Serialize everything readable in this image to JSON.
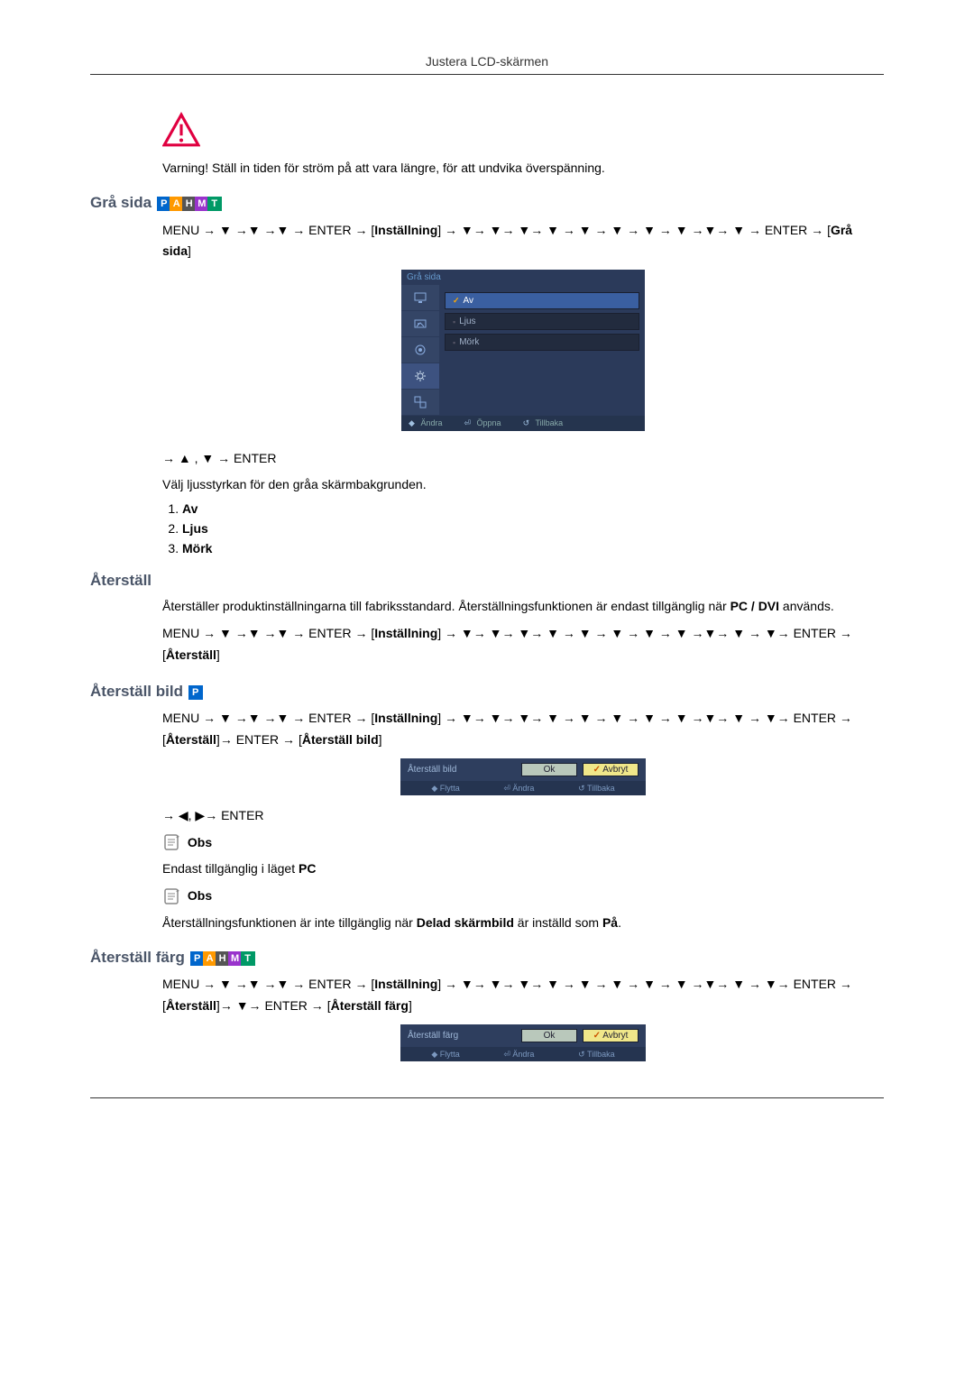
{
  "header": {
    "title": "Justera LCD-skärmen"
  },
  "warning": {
    "text": "Varning! Ställ in tiden för ström på att vara längre, för att undvika överspänning."
  },
  "sec_gra": {
    "title": "Grå sida",
    "badges": [
      "P",
      "A",
      "H",
      "M",
      "T"
    ],
    "path_prefix": "MENU → ▼ →▼ →▼ → ENTER → ",
    "path_bracket1": "Inställning",
    "path_mid": " → ▼→ ▼→ ▼→ ▼ → ▼ → ▼ → ▼ → ▼ →▼→ ▼ → ENTER → ",
    "path_bracket2": "Grå sida",
    "osd": {
      "title": "Grå sida",
      "items": [
        "Av",
        "Ljus",
        "Mörk"
      ],
      "selected_index": 0,
      "footer": {
        "a": "Ändra",
        "b": "Öppna",
        "c": "Tillbaka"
      }
    },
    "post_nav": "→ ▲ , ▼ → ENTER",
    "desc": "Välj ljusstyrkan för den gråa skärmbakgrunden.",
    "options": [
      "Av",
      "Ljus",
      "Mörk"
    ]
  },
  "sec_reset": {
    "title": "Återställ",
    "desc": "Återställer produktinställningarna till fabriksstandard. Återställningsfunktionen är endast tillgänglig när PC / DVI används.",
    "desc_bold": "PC / DVI",
    "path_prefix": "MENU → ▼ →▼ →▼ → ENTER → ",
    "path_bracket1": "Inställning",
    "path_mid": " → ▼→ ▼→ ▼→ ▼ → ▼ → ▼ → ▼ → ▼ →▼→ ▼ → ▼→ ENTER → ",
    "path_bracket2": "Återställ"
  },
  "sec_reset_pic": {
    "title": "Återställ bild",
    "badges": [
      "P"
    ],
    "path_prefix": "MENU → ▼ →▼ →▼ → ENTER → ",
    "path_bracket1": "Inställning",
    "path_mid": " → ▼→ ▼→ ▼→ ▼ → ▼ → ▼ → ▼ → ▼ →▼→ ▼ → ▼→ ENTER → ",
    "path_bracket2": "Återställ",
    "path_after": "→ ENTER → ",
    "path_bracket3": "Återställ bild",
    "dialog": {
      "title": "Återställ bild",
      "ok": "Ok",
      "cancel": "Avbryt",
      "footer": {
        "a": "Flytta",
        "b": "Ändra",
        "c": "Tillbaka"
      }
    },
    "post_nav": "→ ◀, ▶→ ENTER",
    "note_label": "Obs",
    "note1": "Endast tillgänglig i läget PC",
    "note1_bold": "PC",
    "note2": "Återställningsfunktionen är inte tillgänglig när Delad skärmbild är inställd som På.",
    "note2_bold1": "Delad skärmbild",
    "note2_bold2": "På"
  },
  "sec_reset_color": {
    "title": "Återställ färg",
    "badges": [
      "P",
      "A",
      "H",
      "M",
      "T"
    ],
    "path_prefix": "MENU → ▼ →▼ →▼ → ENTER → ",
    "path_bracket1": "Inställning",
    "path_mid": " → ▼→ ▼→ ▼→ ▼ → ▼ → ▼ → ▼ → ▼ →▼→ ▼ → ▼→ ENTER → ",
    "path_bracket2": "Återställ",
    "path_after": "→ ▼→ ENTER → ",
    "path_bracket3": "Återställ färg",
    "dialog": {
      "title": "Återställ färg",
      "ok": "Ok",
      "cancel": "Avbryt",
      "footer": {
        "a": "Flytta",
        "b": "Ändra",
        "c": "Tillbaka"
      }
    }
  }
}
